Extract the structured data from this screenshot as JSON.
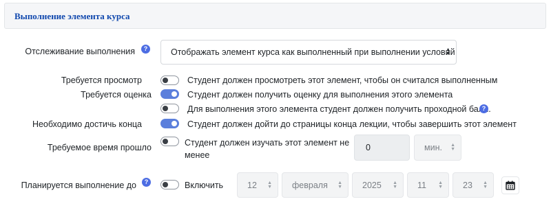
{
  "section": {
    "title": "Выполнение элемента курса"
  },
  "tracking": {
    "label": "Отслеживание выполнения",
    "help_icon": "?",
    "selected": "Отображать элемент курса как выполненный при выполнении условий"
  },
  "conditions": {
    "view": {
      "label": "Требуется просмотр",
      "on": false,
      "text": "Студент должен просмотреть этот элемент, чтобы он считался выполненным"
    },
    "grade": {
      "label": "Требуется оценка",
      "on": true,
      "text": "Студент должен получить оценку для выполнения этого элемента"
    },
    "passgrade": {
      "on": false,
      "text": "Для выполнения этого элемента студент должен получить проходной балл.",
      "help_icon": "?"
    },
    "end": {
      "label": "Необходимо достичь конца",
      "on": true,
      "text": "Студент должен дойти до страницы конца лекции, чтобы завершить этот элемент"
    },
    "time": {
      "label": "Требуемое время прошло",
      "on": false,
      "text_line1": "Студент должен изучать этот элемент не",
      "text_line2": "менее",
      "value": "0",
      "unit": "мин."
    }
  },
  "expected": {
    "label": "Планируется выполнение до",
    "help_icon": "?",
    "enable_label": "Включить",
    "enabled": false,
    "day": "12",
    "month": "февраля",
    "year": "2025",
    "hour": "11",
    "minute": "23"
  },
  "icons": {
    "help": "question-circle-icon",
    "calendar": "calendar-icon",
    "select_arrows": "sort-arrows-icon"
  },
  "colors": {
    "accent": "#5b7fdc",
    "header_text": "#0f47ad",
    "help": "#4d6de3"
  }
}
